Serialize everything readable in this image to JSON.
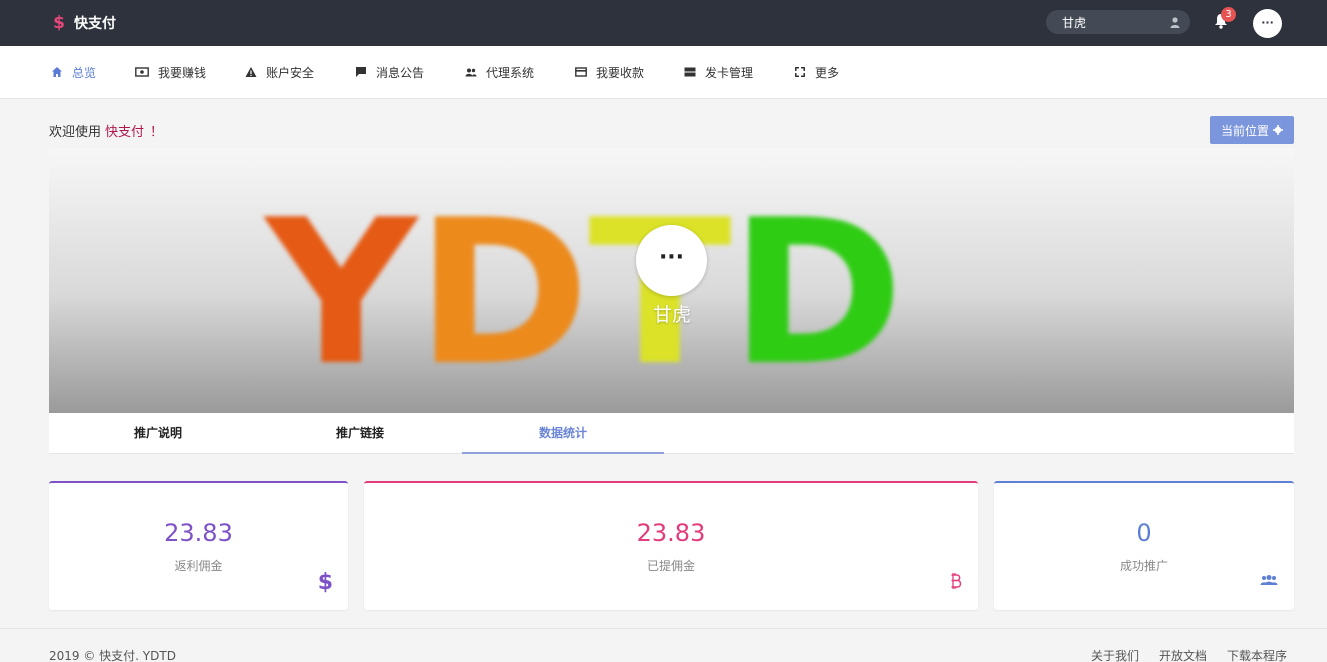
{
  "header": {
    "brand_icon": "$",
    "brand_name": "快支付",
    "user_name": "甘虎",
    "notification_count": "3",
    "avatar_text": "···"
  },
  "nav": {
    "items": [
      {
        "label": "总览",
        "icon": "home-icon"
      },
      {
        "label": "我要赚钱",
        "icon": "money-icon"
      },
      {
        "label": "账户安全",
        "icon": "warning-icon"
      },
      {
        "label": "消息公告",
        "icon": "message-icon"
      },
      {
        "label": "代理系统",
        "icon": "users-icon"
      },
      {
        "label": "我要收款",
        "icon": "card-icon"
      },
      {
        "label": "发卡管理",
        "icon": "server-icon"
      },
      {
        "label": "更多",
        "icon": "expand-icon"
      }
    ]
  },
  "welcome": {
    "prefix": "欢迎使用",
    "highlight": "快支付",
    "suffix": "！"
  },
  "location_button": "当前位置",
  "hero": {
    "banner_letters": [
      "Y",
      "D",
      "T",
      "D"
    ],
    "avatar_text": "···",
    "user_name": "甘虎"
  },
  "tabs": [
    {
      "label": "推广说明",
      "active": false
    },
    {
      "label": "推广链接",
      "active": false
    },
    {
      "label": "数据统计",
      "active": true
    }
  ],
  "stats": [
    {
      "value": "23.83",
      "label": "返利佣金",
      "color": "#7d52c8",
      "icon": "dollar-icon"
    },
    {
      "value": "23.83",
      "label": "已提佣金",
      "color": "#e23c7c",
      "icon": "bitcoin-icon"
    },
    {
      "value": "0",
      "label": "成功推广",
      "color": "#5e80d4",
      "icon": "users-icon"
    }
  ],
  "footer": {
    "copyright": "2019 © 快支付. YDTD",
    "links": [
      "关于我们",
      "开放文档",
      "下载本程序"
    ]
  },
  "colors": {
    "topbar": "#2d323c",
    "accent": "#5b7bd6",
    "brand": "#e8477a"
  }
}
